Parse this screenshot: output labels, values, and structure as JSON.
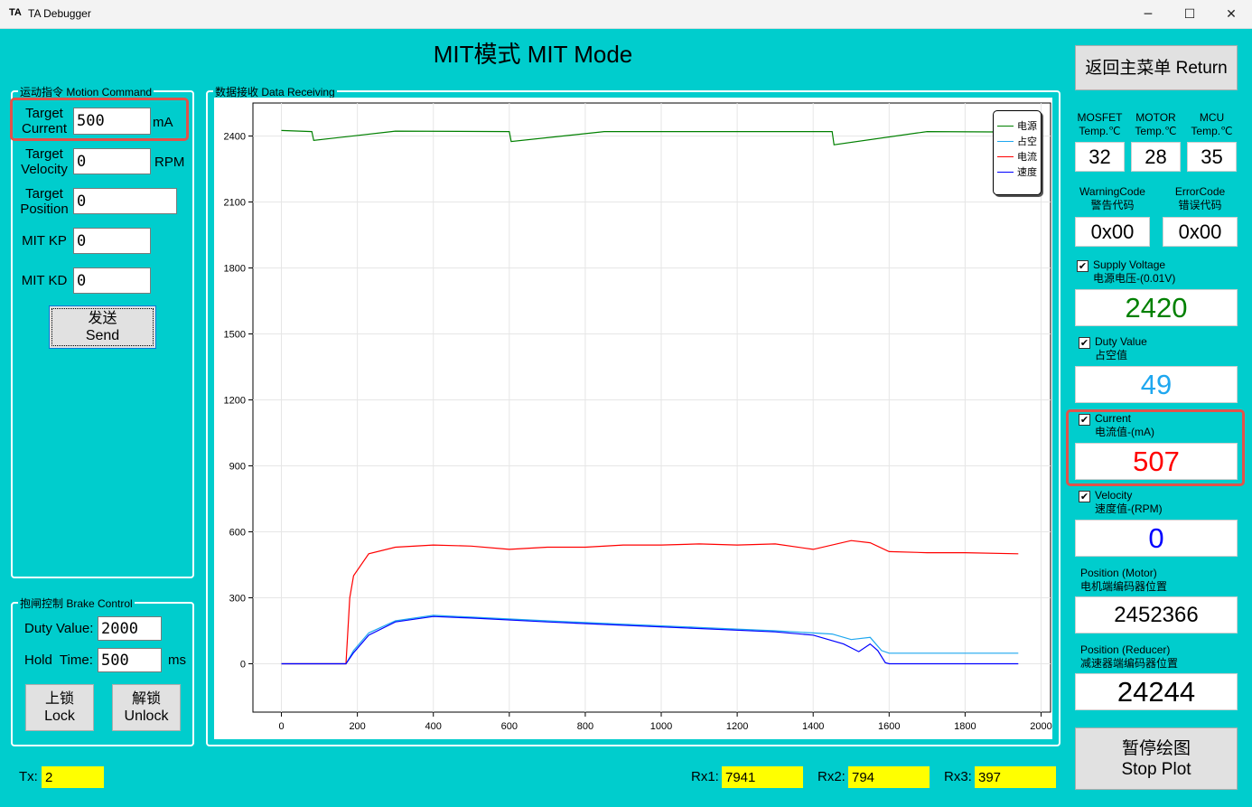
{
  "window": {
    "icon_text": "TA",
    "title": "TA Debugger",
    "minimize_glyph": "─",
    "maximize_glyph": "☐",
    "close_glyph": "✕"
  },
  "page_title": "MIT模式 MIT Mode",
  "motion_command": {
    "legend": "运动指令 Motion Command",
    "target_current": {
      "label_line1": "Target",
      "label_line2": "Current",
      "value": "500",
      "unit": "mA"
    },
    "target_velocity": {
      "label_line1": "Target",
      "label_line2": "Velocity",
      "value": "0",
      "unit": "RPM"
    },
    "target_position": {
      "label_line1": "Target",
      "label_line2": "Position",
      "value": "0"
    },
    "mit_kp": {
      "label": "MIT KP",
      "value": "0"
    },
    "mit_kd": {
      "label": "MIT KD",
      "value": "0"
    },
    "send_button": {
      "line1": "发送",
      "line2": "Send"
    }
  },
  "brake_control": {
    "legend": "抱闸控制 Brake Control",
    "duty_value": {
      "label": "Duty Value:",
      "value": "2000"
    },
    "hold_time": {
      "label": "Hold  Time:",
      "value": "500",
      "unit": "ms"
    },
    "lock_button": {
      "line1": "上锁",
      "line2": "Lock"
    },
    "unlock_button": {
      "line1": "解锁",
      "line2": "Unlock"
    }
  },
  "data_receiving": {
    "legend": "数据接收 Data Receiving"
  },
  "right_panel": {
    "return_button": "返回主菜单 Return",
    "temps": [
      {
        "line1": "MOSFET",
        "line2": "Temp.℃",
        "value": "32"
      },
      {
        "line1": "MOTOR",
        "line2": "Temp.℃",
        "value": "28"
      },
      {
        "line1": "MCU",
        "line2": "Temp.℃",
        "value": "35"
      }
    ],
    "warning": {
      "line1": "WarningCode",
      "line2": "警告代码",
      "value": "0x00"
    },
    "error": {
      "line1": "ErrorCode",
      "line2": "错误代码",
      "value": "0x00"
    },
    "supply_voltage": {
      "checked": "✔",
      "line1": "Supply Voltage",
      "line2": "电源电压-(0.01V)",
      "value": "2420",
      "color": "#008000"
    },
    "duty_value": {
      "checked": "✔",
      "line1": "Duty Value",
      "line2": "占空值",
      "value": "49",
      "color": "#1ea7ef"
    },
    "current": {
      "checked": "✔",
      "line1": "Current",
      "line2": "电流值-(mA)",
      "value": "507",
      "color": "#ff0000"
    },
    "velocity": {
      "checked": "✔",
      "line1": "Velocity",
      "line2": "速度值-(RPM)",
      "value": "0",
      "color": "#0000ff"
    },
    "position_motor": {
      "line1": "Position (Motor)",
      "line2": "电机端编码器位置",
      "value": "2452366"
    },
    "position_reducer": {
      "line1": "Position (Reducer)",
      "line2": "减速器端编码器位置",
      "value": "24244"
    },
    "stop_plot_button": {
      "line1": "暂停绘图",
      "line2": "Stop Plot"
    }
  },
  "status_bar": {
    "tx": {
      "label": "Tx:",
      "value": "2"
    },
    "rx1": {
      "label": "Rx1:",
      "value": "7941"
    },
    "rx2": {
      "label": "Rx2:",
      "value": "794"
    },
    "rx3": {
      "label": "Rx3:",
      "value": "397"
    }
  },
  "chart_data": {
    "type": "line",
    "xlim": [
      -75,
      2025
    ],
    "ylim": [
      -220,
      2550
    ],
    "x_ticks": [
      "0",
      "200",
      "400",
      "600",
      "800",
      "1000",
      "1200",
      "1400",
      "1600",
      "1800",
      "2000"
    ],
    "y_ticks": [
      "0",
      "300",
      "600",
      "900",
      "1200",
      "1500",
      "1800",
      "2100",
      "2400"
    ],
    "x_tick_values": [
      0,
      200,
      400,
      600,
      800,
      1000,
      1200,
      1400,
      1600,
      1800,
      2000
    ],
    "y_tick_values": [
      0,
      300,
      600,
      900,
      1200,
      1500,
      1800,
      2100,
      2400
    ],
    "grid": true,
    "legend_position": "top-right",
    "series": [
      {
        "name": "电源",
        "color": "#008000",
        "x": [
          0,
          80,
          85,
          300,
          600,
          605,
          850,
          1150,
          1450,
          1455,
          1700,
          1940
        ],
        "y": [
          2425,
          2420,
          2380,
          2422,
          2420,
          2375,
          2420,
          2420,
          2420,
          2360,
          2420,
          2418
        ]
      },
      {
        "name": "占空",
        "color": "#1ea7ef",
        "x": [
          0,
          170,
          190,
          230,
          300,
          400,
          500,
          700,
          900,
          1100,
          1300,
          1450,
          1500,
          1550,
          1580,
          1600,
          1940
        ],
        "y": [
          0,
          0,
          60,
          140,
          195,
          220,
          212,
          195,
          180,
          165,
          150,
          135,
          110,
          120,
          60,
          48,
          48
        ]
      },
      {
        "name": "电流",
        "color": "#ff0000",
        "x": [
          0,
          170,
          180,
          190,
          230,
          300,
          400,
          500,
          600,
          700,
          800,
          900,
          1000,
          1100,
          1200,
          1300,
          1400,
          1500,
          1550,
          1600,
          1700,
          1800,
          1940
        ],
        "y": [
          0,
          0,
          300,
          400,
          500,
          530,
          540,
          535,
          520,
          530,
          530,
          540,
          540,
          545,
          540,
          545,
          520,
          560,
          550,
          510,
          505,
          505,
          500
        ]
      },
      {
        "name": "速度",
        "color": "#0000ff",
        "x": [
          0,
          170,
          190,
          230,
          300,
          400,
          500,
          700,
          900,
          1100,
          1300,
          1400,
          1480,
          1520,
          1550,
          1570,
          1590,
          1600,
          1940
        ],
        "y": [
          0,
          0,
          50,
          130,
          190,
          215,
          208,
          190,
          175,
          160,
          145,
          130,
          90,
          55,
          90,
          60,
          5,
          0,
          0
        ]
      }
    ]
  }
}
